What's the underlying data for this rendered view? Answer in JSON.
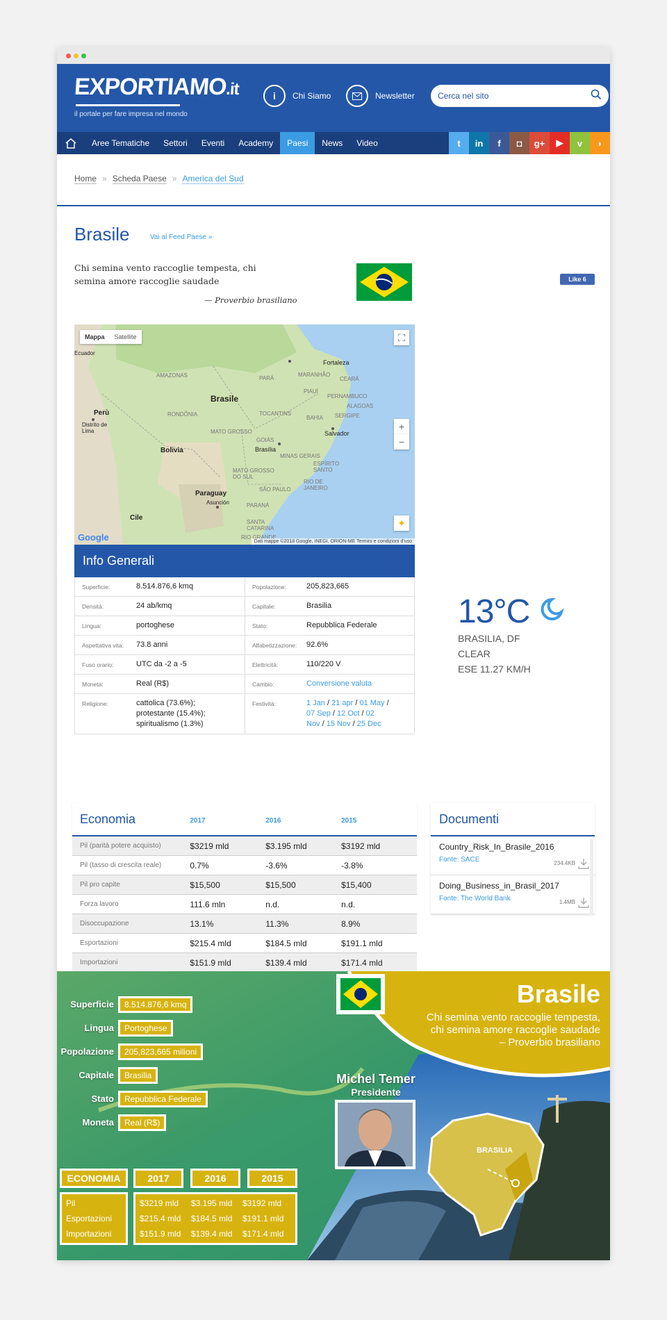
{
  "header": {
    "logo_main": "EXPORTIAMO",
    "logo_tld": ".it",
    "tagline": "il portale per fare impresa nel mondo",
    "chi_siamo": "Chi Siamo",
    "newsletter": "Newsletter",
    "search_placeholder": "Cerca nel sito"
  },
  "nav": {
    "items": [
      "Aree Tematiche",
      "Settori",
      "Eventi",
      "Academy",
      "Paesi",
      "News",
      "Video"
    ],
    "active": "Paesi",
    "social": [
      {
        "icon": "twitter-icon",
        "glyph": "t",
        "color": "#55acee"
      },
      {
        "icon": "linkedin-icon",
        "glyph": "in",
        "color": "#0e76a8"
      },
      {
        "icon": "facebook-icon",
        "glyph": "f",
        "color": "#3b5998"
      },
      {
        "icon": "instagram-icon",
        "glyph": "◘",
        "color": "#8a5a44"
      },
      {
        "icon": "googleplus-icon",
        "glyph": "g+",
        "color": "#dd4b39"
      },
      {
        "icon": "youtube-icon",
        "glyph": "▶",
        "color": "#e52d27"
      },
      {
        "icon": "vimeo-icon",
        "glyph": "v",
        "color": "#8fc33f"
      },
      {
        "icon": "rss-icon",
        "glyph": "◗",
        "color": "#f7981d"
      }
    ]
  },
  "breadcrumb": {
    "items": [
      "Home",
      "Scheda Paese",
      "America del Sud"
    ],
    "sep": "»"
  },
  "page": {
    "title": "Brasile",
    "feed_link": "Vai al Feed Paese »",
    "quote": "Chi semina vento raccoglie tempesta, chi semina amore raccoglie saudade",
    "quote_author": "— Proverbio brasiliano",
    "like_label": "Like 6"
  },
  "map": {
    "tab_map": "Mappa",
    "tab_satellite": "Satellite",
    "google": "Google",
    "copyright": "Dati mappe ©2018 Google, INEGI, ORION-ME   Termini e condizioni d'uso",
    "labels": [
      "Brasile",
      "Perù",
      "Bolivia",
      "Paraguay",
      "Cile",
      "Ecuador",
      "Fortaleza",
      "Salvador",
      "Brasília",
      "Distrito de Lima",
      "Asunción",
      "AMAZONAS",
      "PARÁ",
      "MARANHÃO",
      "PIAUÍ",
      "CEARÁ",
      "BAHIA",
      "TOCANTINS",
      "RONDÔNIA",
      "MATO GROSSO",
      "GOIÁS",
      "MINAS GERAIS",
      "MATO GROSSO DO SUL",
      "SÃO PAULO",
      "PARANÁ",
      "SANTA CATARINA",
      "RIO GRANDE",
      "ESPÍRITO SANTO",
      "RIO DE JANEIRO",
      "ALAGOAS",
      "SERGIPE",
      "PERNAMBUCO"
    ]
  },
  "info": {
    "title": "Info Generali",
    "rows": [
      [
        {
          "l": "Superficie:",
          "v": "8.514.876,6 kmq"
        },
        {
          "l": "Popolazione:",
          "v": "205,823,665"
        }
      ],
      [
        {
          "l": "Densità:",
          "v": "24 ab/kmq"
        },
        {
          "l": "Capitale:",
          "v": "Brasilia"
        }
      ],
      [
        {
          "l": "Lingua:",
          "v": "portoghese"
        },
        {
          "l": "Stato:",
          "v": "Repubblica Federale"
        }
      ],
      [
        {
          "l": "Aspettativa vita:",
          "v": "73.8 anni"
        },
        {
          "l": "Alfabetizzazione:",
          "v": "92.6%"
        }
      ],
      [
        {
          "l": "Fuso orario:",
          "v": "UTC da -2 a -5"
        },
        {
          "l": "Elettricità:",
          "v": "110/220 V"
        }
      ],
      [
        {
          "l": "Moneta:",
          "v": "Real (R$)"
        },
        {
          "l": "Cambio:",
          "v": "Conversione valuta"
        }
      ]
    ],
    "religione_label": "Religione:",
    "religione": [
      "cattolica (73.6%);",
      "protestante (15.4%);",
      "spiritualismo (1.3%)"
    ],
    "festivita_label": "Festività:",
    "festivita": [
      "1 Jan",
      "21 apr",
      "01 May",
      "07 Sep",
      "12 Oct",
      "02 Nov",
      "15 Nov",
      "25 Dec"
    ]
  },
  "weather": {
    "temp": "13°C",
    "city": "BRASILIA, DF",
    "condition": "CLEAR",
    "wind": "ESE 11.27 KM/H",
    "icon": "moon-icon"
  },
  "economia": {
    "title": "Economia",
    "years": [
      "2017",
      "2016",
      "2015"
    ],
    "rows": [
      {
        "k": "Pil (parità potere acquisto)",
        "v": [
          "$3219 mld",
          "$3.195 mld",
          "$3192 mld"
        ]
      },
      {
        "k": "Pil (tasso di crescita reale)",
        "v": [
          "0.7%",
          "-3.6%",
          "-3.8%"
        ]
      },
      {
        "k": "Pil pro capite",
        "v": [
          "$15,500",
          "$15,500",
          "$15,400"
        ]
      },
      {
        "k": "Forza lavoro",
        "v": [
          "111.6 mln",
          "n.d.",
          "n.d."
        ]
      },
      {
        "k": "Disoccupazione",
        "v": [
          "13.1%",
          "11.3%",
          "8.9%"
        ]
      },
      {
        "k": "Esportazioni",
        "v": [
          "$215.4 mld",
          "$184.5 mld",
          "$191.1 mld"
        ]
      },
      {
        "k": "Importazioni",
        "v": [
          "$151.9 mld",
          "$139.4 mld",
          "$171.4 mld"
        ]
      }
    ]
  },
  "documenti": {
    "title": "Documenti",
    "items": [
      {
        "name": "Country_Risk_In_Brasile_2016",
        "fonte": "Fonte: SACE",
        "size": "234.4KB"
      },
      {
        "name": "Doing_Business_in_Brasil_2017",
        "fonte": "Fonte: The World Bank",
        "size": "1.4MB"
      }
    ]
  },
  "infographic": {
    "title": "Brasile",
    "quote_lines": [
      "Chi semina vento raccoglie tempesta,",
      "chi semina amore raccoglie saudade",
      "– Proverbio brasiliano"
    ],
    "president_name": "Michel Temer",
    "president_role": "Presidente",
    "capital_label": "BRASILIA",
    "facts": [
      {
        "l": "Superficie",
        "v": "8.514.876,6 kmq"
      },
      {
        "l": "Lingua",
        "v": "Portoghese"
      },
      {
        "l": "Popolazione",
        "v": "205,823,665 milioni"
      },
      {
        "l": "Capitale",
        "v": "Brasilia"
      },
      {
        "l": "Stato",
        "v": "Repubblica Federale"
      },
      {
        "l": "Moneta",
        "v": "Real (R$)"
      }
    ],
    "eco_title": "ECONOMIA",
    "eco_years": [
      "2017",
      "2016",
      "2015"
    ],
    "eco_labels": [
      "Pil",
      "Esportazioni",
      "Importazioni"
    ],
    "eco_values": [
      [
        "$3219 mld",
        "$215.4 mld",
        "$151.9 mld"
      ],
      [
        "$3.195 mld",
        "$184.5 mld",
        "$139.4 mld"
      ],
      [
        "$3192 mld",
        "$191.1 mld",
        "$171.4 mld"
      ]
    ]
  }
}
